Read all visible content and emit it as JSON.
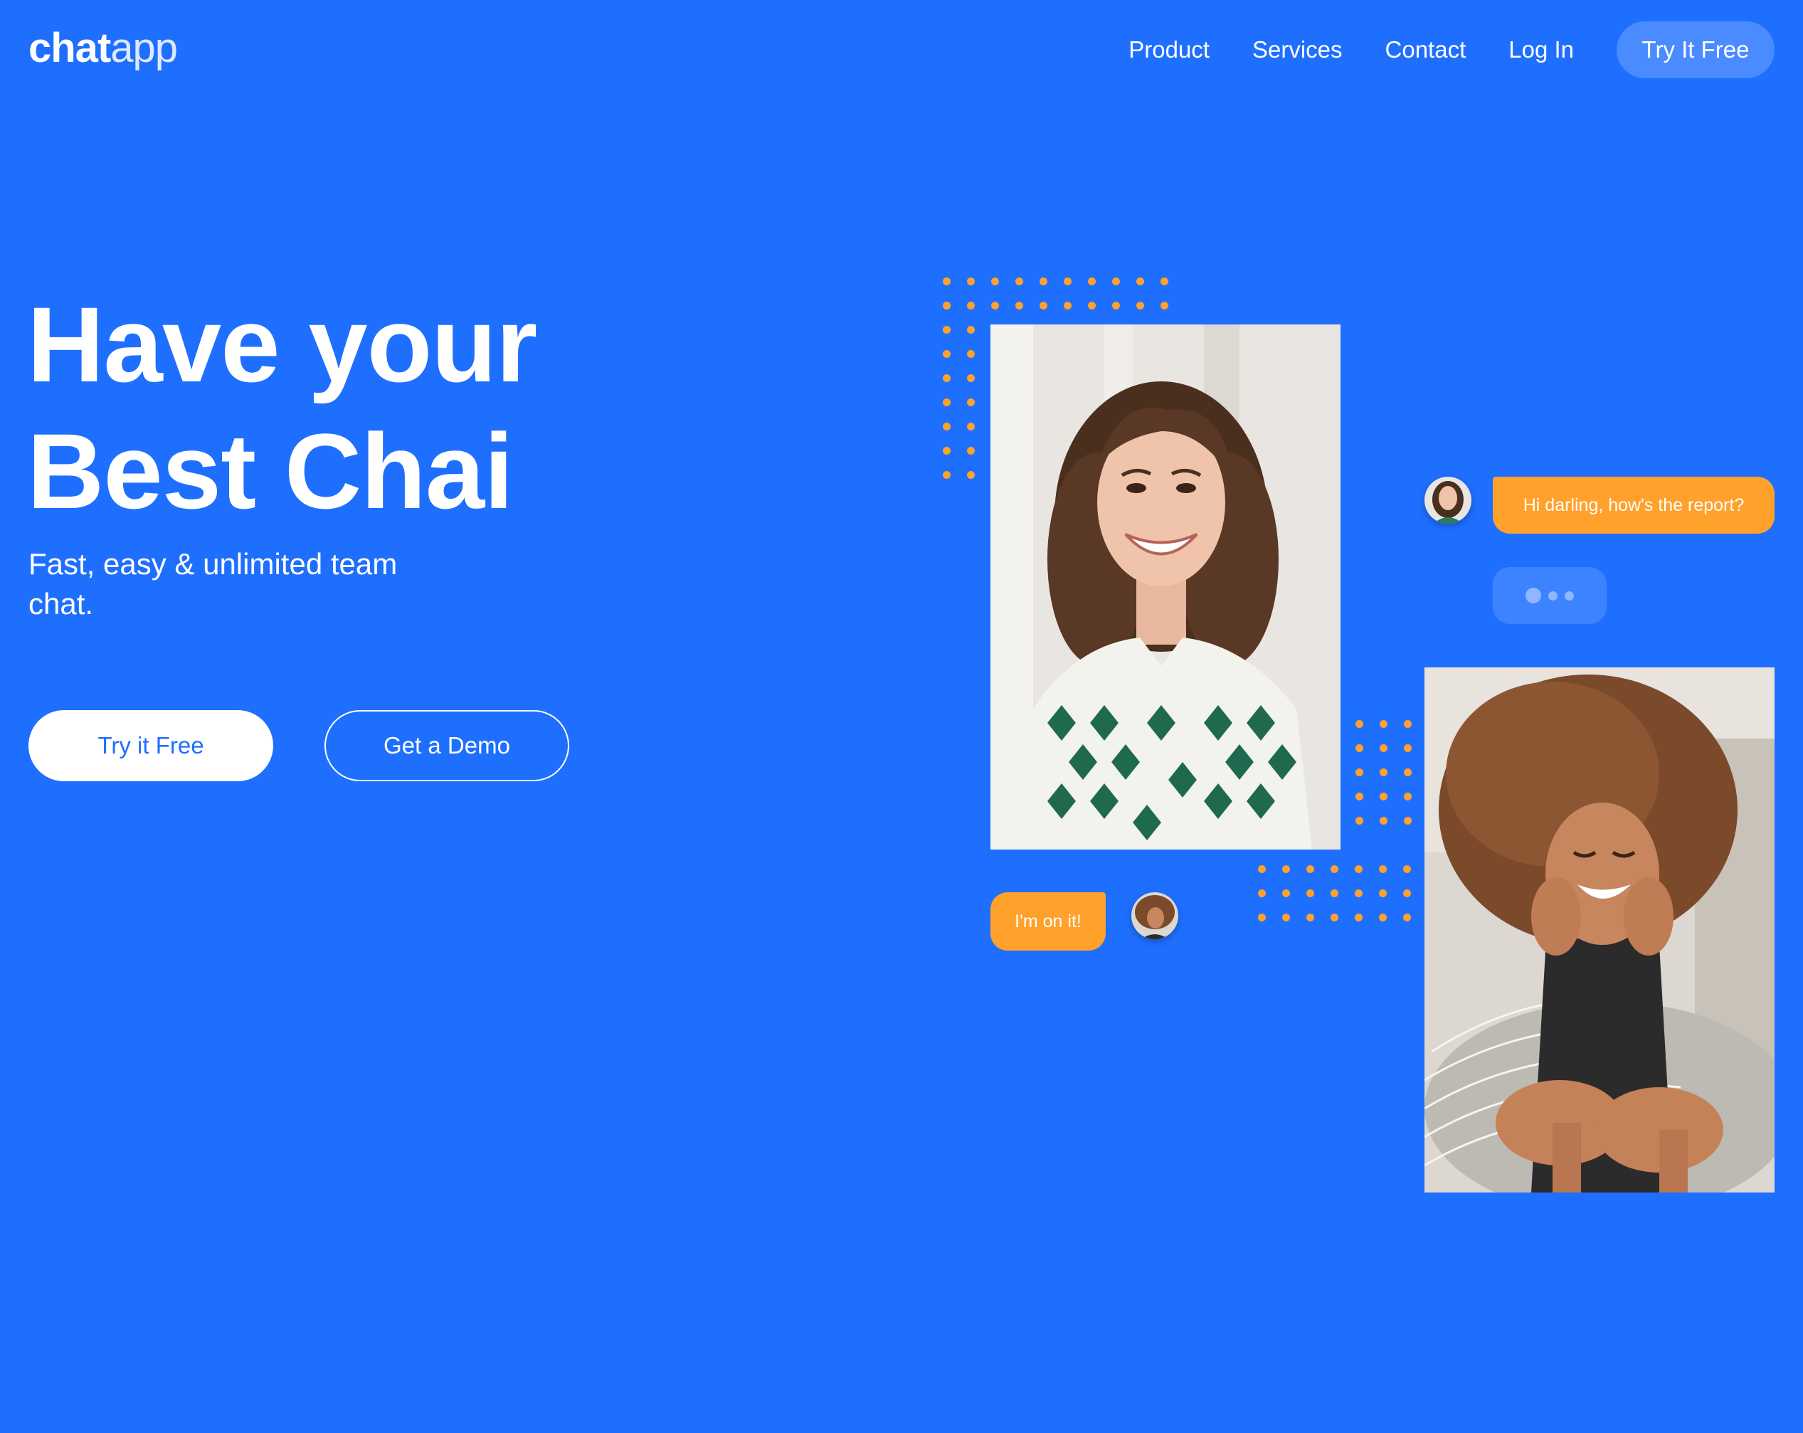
{
  "header": {
    "logo_bold": "chat",
    "logo_light": "app",
    "nav": [
      "Product",
      "Services",
      "Contact",
      "Log In"
    ],
    "cta": "Try It Free"
  },
  "hero": {
    "title_line1": "Have your",
    "title_line2": "Best Chai",
    "subtitle": "Fast, easy & unlimited team chat.",
    "primary_button": "Try it Free",
    "secondary_button": "Get a Demo"
  },
  "chat": {
    "message_1": "Hi darling, how's the report?",
    "message_2": "I'm on it!"
  },
  "colors": {
    "background": "#1F6FFF",
    "accent": "#FFA12B",
    "nav_cta": "#4A8BFF"
  }
}
